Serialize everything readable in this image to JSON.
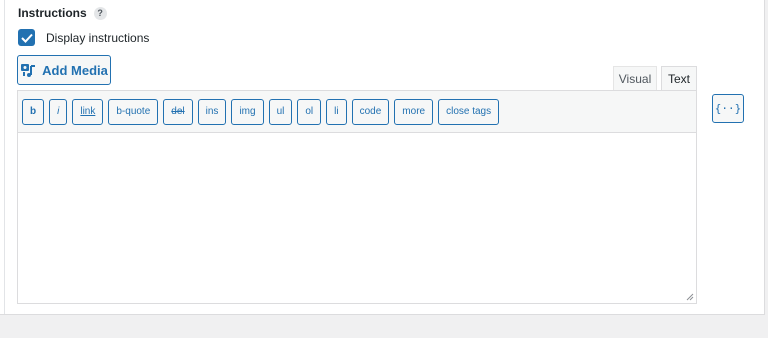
{
  "heading": {
    "label": "Instructions",
    "help": "?"
  },
  "checkbox": {
    "label": "Display instructions",
    "checked": true
  },
  "add_media": {
    "label": "Add Media"
  },
  "tabs": {
    "visual": "Visual",
    "text": "Text"
  },
  "toolbar": {
    "buttons": [
      "b",
      "i",
      "link",
      "b-quote",
      "del",
      "ins",
      "img",
      "ul",
      "ol",
      "li",
      "code",
      "more",
      "close tags"
    ]
  },
  "merge_tag": {
    "label": "{··}"
  },
  "colors": {
    "accent": "#2271b1",
    "panel": "#ffffff",
    "toolbar_bg": "#f6f7f7",
    "border": "#dcdcde"
  }
}
